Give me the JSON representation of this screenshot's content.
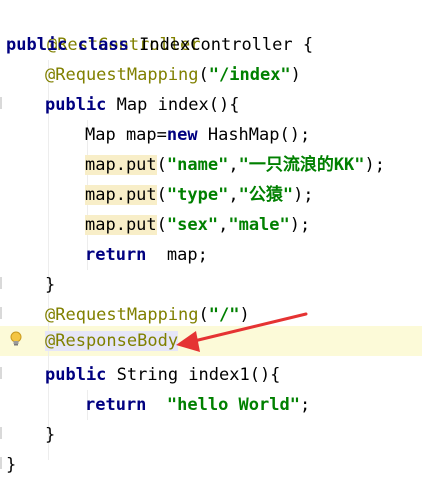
{
  "code": {
    "l1": "@RestController",
    "l2_kw1": "public",
    "l2_kw2": "class",
    "l2_rest": " IndexController {",
    "l3_ann": "@RequestMapping",
    "l3_open": "(",
    "l3_str": "\"/index\"",
    "l3_close": ")",
    "l4_kw": "public",
    "l4_rest": " Map index(){",
    "l5_a": "Map map=",
    "l5_kw": "new",
    "l5_b": " HashMap();",
    "l6_call": "map.put",
    "l6_open": "(",
    "l6_s1": "\"name\"",
    "l6_comma": ",",
    "l6_s2": "\"一只流浪的KK\"",
    "l6_close": ");",
    "l7_call": "map.put",
    "l7_open": "(",
    "l7_s1": "\"type\"",
    "l7_comma": ",",
    "l7_s2": "\"公猿\"",
    "l7_close": ");",
    "l8_call": "map.put",
    "l8_open": "(",
    "l8_s1": "\"sex\"",
    "l8_comma": ",",
    "l8_s2": "\"male\"",
    "l8_close": ");",
    "l9_kw": "return",
    "l9_rest": "  map;",
    "l10": "}",
    "l11_ann": "@RequestMapping",
    "l11_open": "(",
    "l11_str": "\"/\"",
    "l11_close": ")",
    "l12_ann": "@ResponseBody",
    "l13_kw": "public",
    "l13_rest": " String index1(){",
    "l14_kw": "return",
    "l14_sp": "  ",
    "l14_str": "\"hello World\"",
    "l14_end": ";",
    "l15": "}",
    "l16": "}"
  },
  "colors": {
    "keyword": "#000080",
    "annotation": "#808000",
    "string": "#008000",
    "arrow": "#e53333",
    "current_line": "#fcfad8"
  },
  "icons": {
    "intention": "lightbulb-icon",
    "pointer": "red-arrow-annotation"
  }
}
